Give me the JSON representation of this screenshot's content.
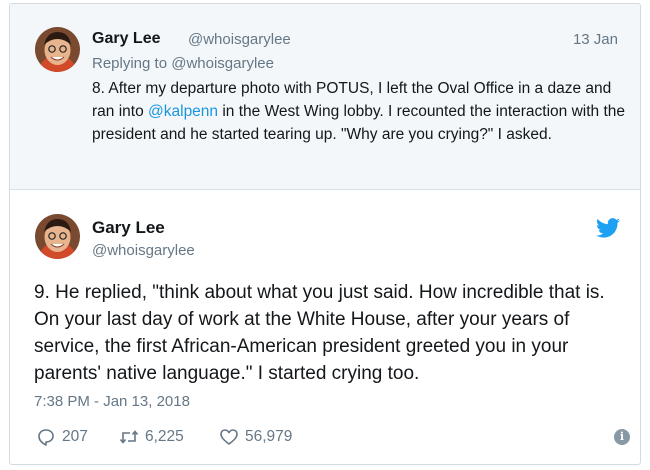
{
  "parent_tweet": {
    "name": "Gary Lee",
    "handle": "@whoisgarylee",
    "date": "13 Jan",
    "replying_prefix": "Replying to ",
    "replying_handle": "@whoisgarylee",
    "text_before_mention": "8. After my departure photo with POTUS, I left the Oval Office in a daze and ran into ",
    "mention": "@kalpenn",
    "text_after_mention": " in the West Wing lobby. I recounted the interaction with the president and he started tearing up. \"Why are you crying?\" I asked."
  },
  "main_tweet": {
    "name": "Gary Lee",
    "handle": "@whoisgarylee",
    "text": "9. He replied, \"think about what you just said. How incredible that is. On your last day of work at the White House, after your years of service, the first African-American president greeted you in your parents' native language.\" I started crying too.",
    "timestamp": "7:38 PM - Jan 13, 2018",
    "reply_count": "207",
    "retweet_count": "6,225",
    "like_count": "56,979",
    "info_glyph": "i"
  },
  "icons": {
    "brand": "twitter-bird-icon",
    "reply": "reply-icon",
    "retweet": "retweet-icon",
    "like": "heart-icon",
    "info": "info-icon"
  },
  "colors": {
    "link": "#1b95e0",
    "brand": "#1da1f2",
    "secondary_text": "#657786",
    "parent_background": "#f3f7fa"
  }
}
